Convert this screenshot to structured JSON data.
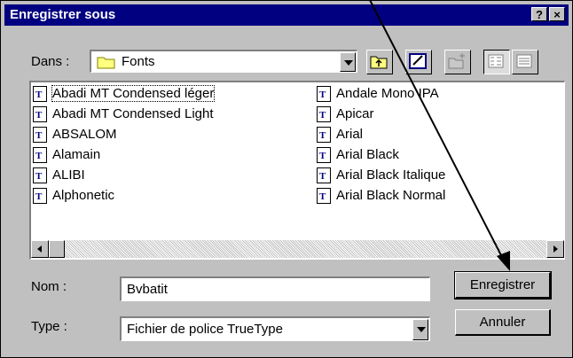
{
  "title": "Enregistrer sous",
  "titlebar_buttons": {
    "help": "?",
    "close": "×"
  },
  "look_in": {
    "label": "Dans :",
    "value": "Fonts"
  },
  "toolbar": [
    "up-one-level-icon",
    "desktop-icon",
    "new-folder-icon",
    "list-view-icon",
    "details-view-icon"
  ],
  "files_col1": [
    "Abadi MT Condensed léger",
    "Abadi MT Condensed Light",
    "ABSALOM",
    "Alamain",
    "ALIBI",
    "Alphonetic"
  ],
  "files_col2": [
    "Andale Mono IPA",
    "Apicar",
    "Arial",
    "Arial Black",
    "Arial Black Italique",
    "Arial Black Normal"
  ],
  "filename": {
    "label": "Nom :",
    "value": "Bvbatit"
  },
  "filetype": {
    "label": "Type :",
    "value": "Fichier de police TrueType"
  },
  "buttons": {
    "save": "Enregistrer",
    "cancel": "Annuler"
  },
  "colors": {
    "titlebar": "#000080",
    "face": "#c0c0c0",
    "file_icon": "#000080"
  }
}
